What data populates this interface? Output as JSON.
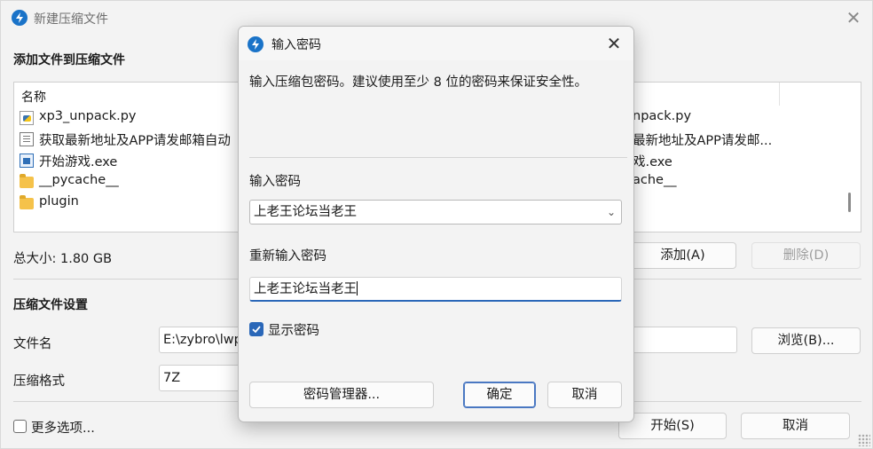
{
  "window": {
    "title": "新建压缩文件",
    "close_label": "✕",
    "add_section_title": "添加文件到压缩文件",
    "file_list": {
      "column_name": "名称",
      "items": [
        {
          "name": "xp3_unpack.py",
          "icon": "python-file-icon",
          "dup": "npack.py"
        },
        {
          "name": "获取最新地址及APP请发邮箱自动",
          "icon": "text-file-icon",
          "dup": "最新地址及APP请发邮..."
        },
        {
          "name": "开始游戏.exe",
          "icon": "exe-file-icon",
          "dup": "戏.exe"
        },
        {
          "name": "__pycache__",
          "icon": "folder-icon",
          "dup": "ache__"
        },
        {
          "name": "plugin",
          "icon": "folder-icon",
          "dup": ""
        }
      ]
    },
    "total_size": "总大小: 1.80 GB",
    "add_button": "添加(A)",
    "remove_button": "删除(D)",
    "settings_title": "压缩文件设置",
    "filename_label": "文件名",
    "filename_value": "E:\\zybro\\lwp",
    "browse_button": "浏览(B)...",
    "format_label": "压缩格式",
    "format_value": "7Z",
    "more_options_label": "更多选项...",
    "start_button": "开始(S)",
    "cancel_button": "取消"
  },
  "dialog": {
    "title": "输入密码",
    "close_label": "✕",
    "description": "输入压缩包密码。建议使用至少 8 位的密码来保证安全性。",
    "password_label": "输入密码",
    "password_value": "上老王论坛当老王",
    "confirm_label": "重新输入密码",
    "confirm_value": "上老王论坛当老王",
    "show_password_label": "显示密码",
    "show_password_checked": true,
    "password_manager_button": "密码管理器...",
    "ok_button": "确定",
    "cancel_button": "取消"
  },
  "colors": {
    "accent": "#2a67b8",
    "app_icon": "#1a73c8"
  }
}
